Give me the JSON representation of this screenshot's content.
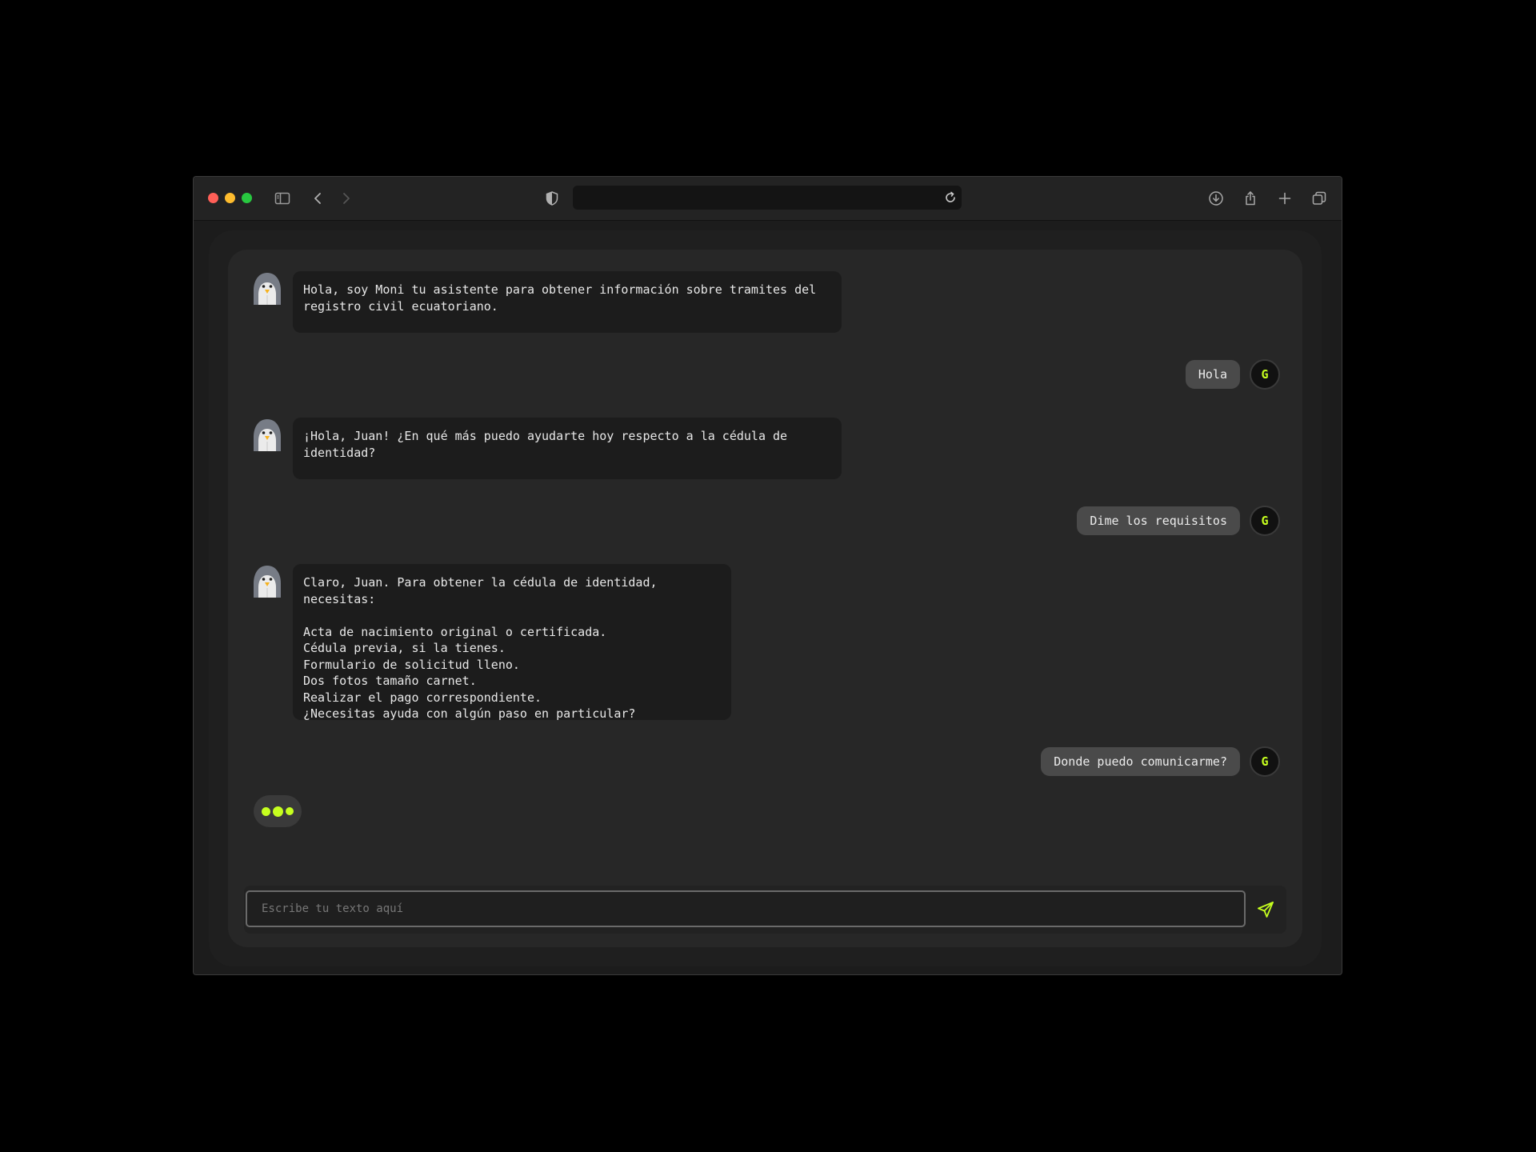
{
  "browser": {
    "icons": {
      "sidebar": "sidebar-icon",
      "back": "chevron-left-icon",
      "forward": "chevron-right-icon",
      "privacy": "shield-icon",
      "reload": "reload-icon",
      "download": "download-icon",
      "share": "share-icon",
      "new_tab": "plus-icon",
      "tabs": "tabs-overview-icon"
    },
    "traffic_lights": [
      "#ff5f57",
      "#febc2e",
      "#28c840"
    ]
  },
  "chat": {
    "messages": [
      {
        "role": "bot",
        "text": "Hola, soy Moni tu asistente para obtener información sobre tramites del\nregistro civil ecuatoriano."
      },
      {
        "role": "user",
        "text": "Hola",
        "avatar": "G"
      },
      {
        "role": "bot",
        "text": "¡Hola, Juan! ¿En qué más puedo ayudarte hoy respecto a la cédula de\nidentidad?"
      },
      {
        "role": "user",
        "text": "Dime los requisitos",
        "avatar": "G"
      },
      {
        "role": "bot",
        "text": "Claro, Juan. Para obtener la cédula de identidad, necesitas:\n\nActa de nacimiento original o certificada.\nCédula previa, si la tienes.\nFormulario de solicitud lleno.\nDos fotos tamaño carnet.\nRealizar el pago correspondiente.\n¿Necesitas ayuda con algún paso en particular?"
      },
      {
        "role": "user",
        "text": "Donde puedo comunicarme?",
        "avatar": "G"
      }
    ],
    "typing_indicator": true
  },
  "input": {
    "placeholder": "Escribe tu texto aquí",
    "value": "",
    "send_icon": "send-icon"
  },
  "colors": {
    "accent": "#c6ff1f",
    "background": "#000000",
    "chat_panel": "#272727",
    "bot_bubble": "#1c1c1c",
    "user_bubble": "#4a4a4a"
  }
}
